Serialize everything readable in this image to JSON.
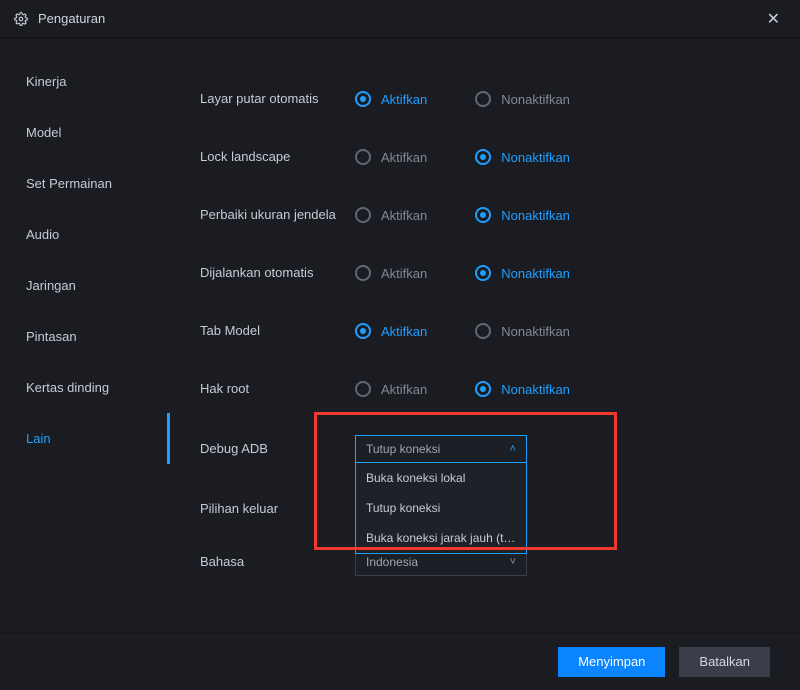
{
  "title": "Pengaturan",
  "sidebar": {
    "items": [
      {
        "label": "Kinerja"
      },
      {
        "label": "Model"
      },
      {
        "label": "Set Permainan"
      },
      {
        "label": "Audio"
      },
      {
        "label": "Jaringan"
      },
      {
        "label": "Pintasan"
      },
      {
        "label": "Kertas dinding"
      },
      {
        "label": "Lain"
      }
    ],
    "activeIndex": 7
  },
  "main": {
    "radioRows": [
      {
        "label": "Layar putar otomatis",
        "enable": "Aktifkan",
        "disable": "Nonaktifkan",
        "value": "enable"
      },
      {
        "label": "Lock landscape",
        "enable": "Aktifkan",
        "disable": "Nonaktifkan",
        "value": "disable"
      },
      {
        "label": "Perbaiki ukuran jendela",
        "enable": "Aktifkan",
        "disable": "Nonaktifkan",
        "value": "disable"
      },
      {
        "label": "Dijalankan otomatis",
        "enable": "Aktifkan",
        "disable": "Nonaktifkan",
        "value": "disable"
      },
      {
        "label": "Tab Model",
        "enable": "Aktifkan",
        "disable": "Nonaktifkan",
        "value": "enable"
      },
      {
        "label": "Hak root",
        "enable": "Aktifkan",
        "disable": "Nonaktifkan",
        "value": "disable"
      }
    ],
    "debugAdb": {
      "label": "Debug ADB",
      "selected": "Tutup koneksi",
      "options": [
        "Buka koneksi lokal",
        "Tutup koneksi",
        "Buka koneksi jarak jauh (ti..."
      ]
    },
    "exitChoice": {
      "label": "Pilihan keluar"
    },
    "language": {
      "label": "Bahasa",
      "selected": "Indonesia"
    }
  },
  "footer": {
    "save": "Menyimpan",
    "cancel": "Batalkan"
  },
  "colors": {
    "accent": "#1f9fff",
    "highlight": "#f03a30"
  }
}
